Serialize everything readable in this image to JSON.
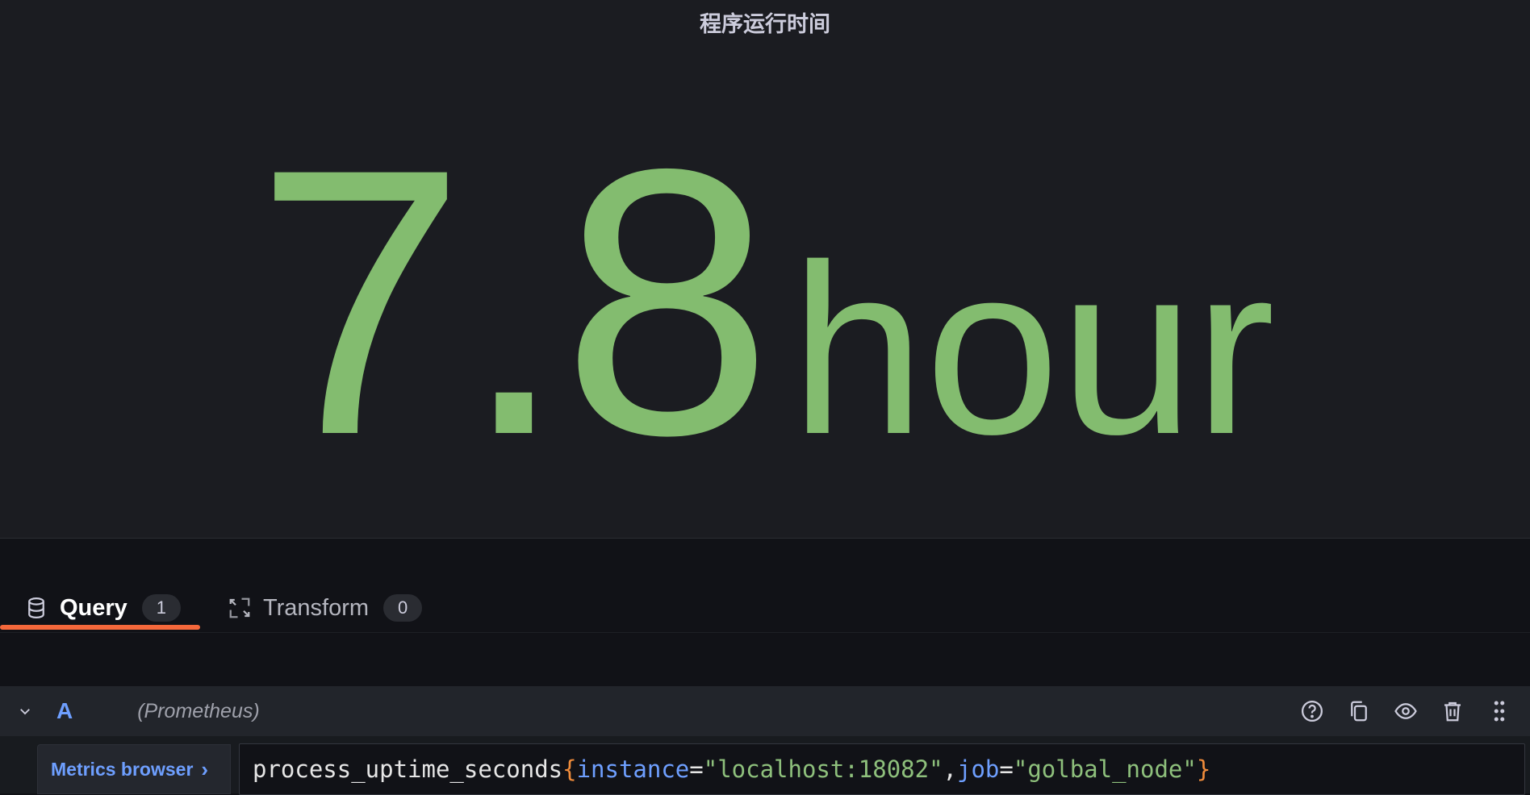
{
  "panel": {
    "title": "程序运行时间",
    "value": "7.8",
    "unit": "hour",
    "value_color": "#83bc6f"
  },
  "tabs": [
    {
      "label": "Query",
      "count": "1",
      "active": true,
      "icon": "database-icon"
    },
    {
      "label": "Transform",
      "count": "0",
      "active": false,
      "icon": "transform-icon"
    }
  ],
  "accent_color": "#f5683b",
  "query": {
    "letter": "A",
    "datasource": "(Prometheus)",
    "metrics_browser_label": "Metrics browser",
    "expression_tokens": [
      {
        "text": "process_uptime_seconds",
        "kind": "metric"
      },
      {
        "text": "{",
        "kind": "brace"
      },
      {
        "text": "instance",
        "kind": "label"
      },
      {
        "text": "=",
        "kind": "op"
      },
      {
        "text": "\"localhost:18082\"",
        "kind": "string"
      },
      {
        "text": ",",
        "kind": "op"
      },
      {
        "text": "job",
        "kind": "label"
      },
      {
        "text": "=",
        "kind": "op"
      },
      {
        "text": "\"golbal_node\"",
        "kind": "string"
      },
      {
        "text": "}",
        "kind": "brace"
      }
    ],
    "actions": [
      "help-icon",
      "duplicate-icon",
      "eye-icon",
      "trash-icon",
      "drag-handle-icon"
    ]
  }
}
